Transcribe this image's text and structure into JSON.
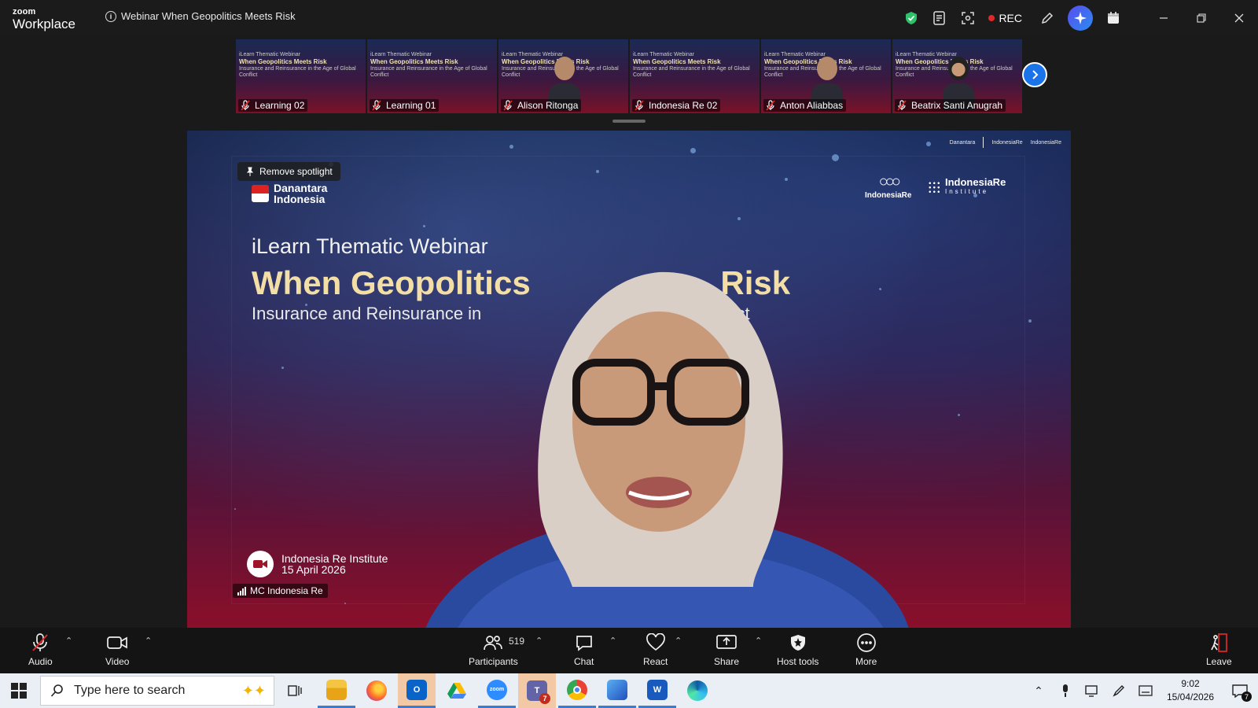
{
  "app": {
    "logo_top": "zoom",
    "logo_bottom": "Workplace"
  },
  "meeting": {
    "title": "Webinar When Geopolitics Meets Risk",
    "rec_label": "REC"
  },
  "thumbnails": [
    {
      "name": "Learning 02",
      "has_person": false
    },
    {
      "name": "Learning 01",
      "has_person": false
    },
    {
      "name": "Alison Ritonga",
      "has_person": true
    },
    {
      "name": "Indonesia Re 02",
      "has_person": false
    },
    {
      "name": "Anton Aliabbas",
      "has_person": true
    },
    {
      "name": "Beatrix Santi Anugrah",
      "has_person": true
    }
  ],
  "thumb_slide": {
    "line1": "iLearn Thematic Webinar",
    "line2": "When Geopolitics Meets Risk",
    "line3": "Insurance and Reinsurance in the Age of Global Conflict"
  },
  "main_video": {
    "spotlight_label": "Remove spotlight",
    "danantara": "Danantara\nIndonesia",
    "danantara_l1": "Danantara",
    "danantara_l2": "Indonesia",
    "ire_label": "IndonesiaRe",
    "iri_label": "IndonesiaRe",
    "iri_sub": "Institute",
    "slide_subtitle": "iLearn Thematic Webinar",
    "slide_title": "When Geopolitics",
    "slide_title_end": "Risk",
    "slide_tagline": "Insurance and Reinsurance in",
    "slide_tagline_end": "nflict",
    "event_org": "Indonesia Re Institute",
    "event_date": "15 April 2026",
    "participant_name": "MC Indonesia Re"
  },
  "toolbar": {
    "audio": "Audio",
    "video": "Video",
    "participants": "Participants",
    "participant_count": "519",
    "chat": "Chat",
    "react": "React",
    "share": "Share",
    "host_tools": "Host tools",
    "more": "More",
    "leave": "Leave"
  },
  "taskbar": {
    "search_placeholder": "Type here to search",
    "time": "9:02",
    "date": "15/04/2026",
    "notification_count": "7",
    "teams_badge": "7"
  },
  "colors": {
    "accent": "#1a73e8",
    "rec": "#e02828",
    "slide_gold": "#f3dfa5",
    "leave": "#e02828"
  }
}
